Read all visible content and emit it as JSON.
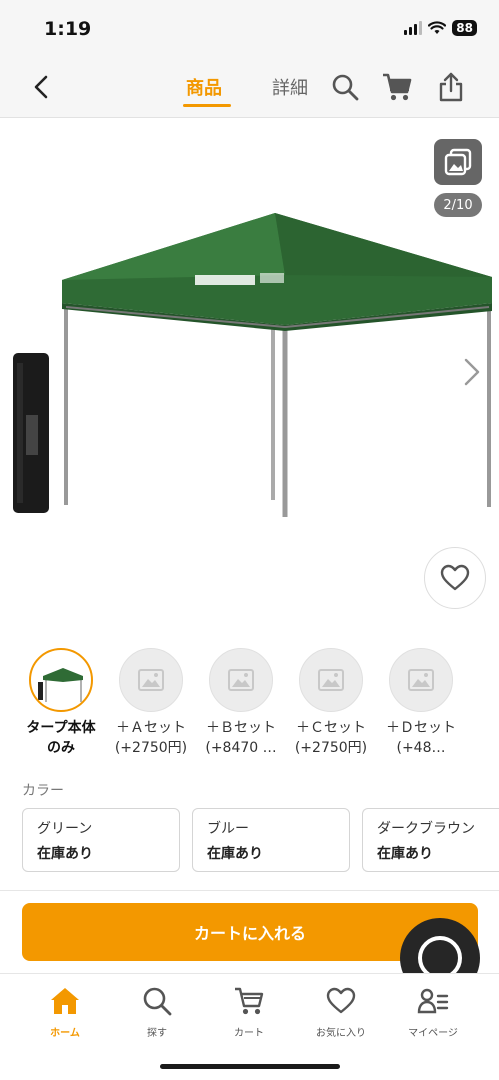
{
  "status_bar": {
    "time": "1:19",
    "battery": "88"
  },
  "header": {
    "tabs": [
      {
        "label": "商品"
      },
      {
        "label": "詳細"
      }
    ]
  },
  "gallery": {
    "counter": "2/10"
  },
  "variants": [
    {
      "label": "タープ本体\nのみ"
    },
    {
      "label": "＋Ａセット\n(+2750円)"
    },
    {
      "label": "＋Ｂセット\n(+8470 …"
    },
    {
      "label": "＋Ｃセット\n(+2750円)"
    },
    {
      "label": "＋Ｄセット\n(+48…"
    }
  ],
  "color": {
    "label": "カラー",
    "options": [
      {
        "name": "グリーン",
        "stock": "在庫あり"
      },
      {
        "name": "ブルー",
        "stock": "在庫あり"
      },
      {
        "name": "ダークブラウン",
        "stock": "在庫あり"
      }
    ]
  },
  "cart_button": {
    "label": "カートに入れる"
  },
  "bottom_nav": [
    {
      "label": "ホーム",
      "icon": "home-icon"
    },
    {
      "label": "探す",
      "icon": "search-icon"
    },
    {
      "label": "カート",
      "icon": "cart-icon"
    },
    {
      "label": "お気に入り",
      "icon": "heart-icon"
    },
    {
      "label": "マイページ",
      "icon": "profile-icon"
    }
  ],
  "colors": {
    "accent": "#f39800",
    "tent_green": "#2f6b35"
  }
}
